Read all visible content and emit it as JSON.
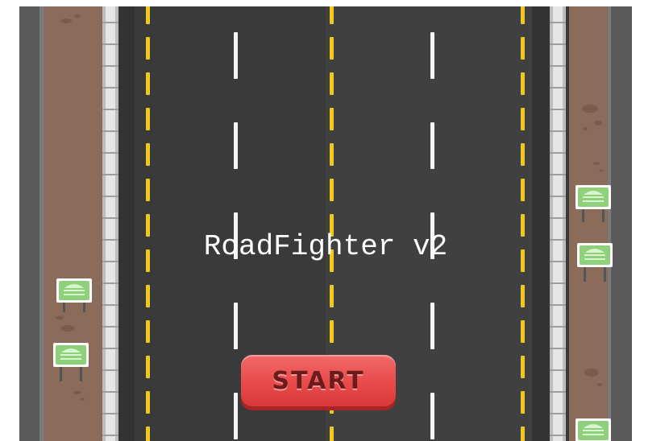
{
  "game": {
    "title": "RoadFighter v2",
    "start_label": "START"
  },
  "colors": {
    "asphalt": "#3a3a3a",
    "lane_yellow": "#f2c81c",
    "lane_white": "#ffffff",
    "dirt": "#8b6b5a",
    "guardrail": "#d9d9d9",
    "sign_green": "#8fd07a",
    "button_red": "#e94a4a"
  }
}
